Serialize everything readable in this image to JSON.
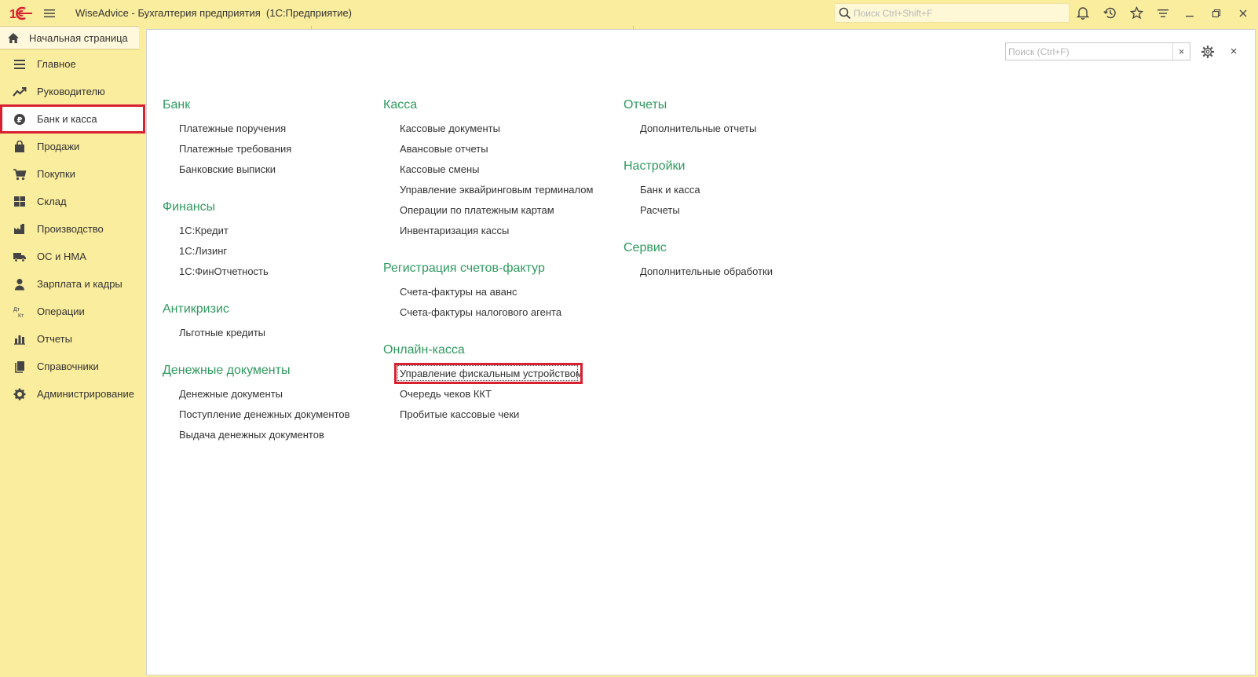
{
  "window": {
    "title": "WiseAdvice - Бухгалтерия предприятия  (1С:Предприятие)",
    "search_placeholder": "Поиск Ctrl+Shift+F"
  },
  "home_tab": {
    "label": "Начальная страница"
  },
  "sidebar": {
    "items": [
      {
        "label": "Главное",
        "icon": "main-menu-icon"
      },
      {
        "label": "Руководителю",
        "icon": "trend-icon"
      },
      {
        "label": "Банк и касса",
        "icon": "ruble-coin-icon",
        "active": true
      },
      {
        "label": "Продажи",
        "icon": "shopping-bag-icon"
      },
      {
        "label": "Покупки",
        "icon": "cart-icon"
      },
      {
        "label": "Склад",
        "icon": "warehouse-icon"
      },
      {
        "label": "Производство",
        "icon": "factory-icon"
      },
      {
        "label": "ОС и НМА",
        "icon": "truck-icon"
      },
      {
        "label": "Зарплата и кадры",
        "icon": "person-icon"
      },
      {
        "label": "Операции",
        "icon": "dt-kt-icon"
      },
      {
        "label": "Отчеты",
        "icon": "bar-chart-icon"
      },
      {
        "label": "Справочники",
        "icon": "books-icon"
      },
      {
        "label": "Администрирование",
        "icon": "gear-icon"
      }
    ]
  },
  "panel": {
    "search_placeholder": "Поиск (Ctrl+F)",
    "clear_label": "×",
    "close_label": "×",
    "columns": [
      {
        "sections": [
          {
            "title": "Банк",
            "links": [
              "Платежные поручения",
              "Платежные требования",
              "Банковские выписки"
            ]
          },
          {
            "title": "Финансы",
            "links": [
              "1С:Кредит",
              "1С:Лизинг",
              "1С:ФинОтчетность"
            ]
          },
          {
            "title": "Антикризис",
            "links": [
              "Льготные кредиты"
            ]
          },
          {
            "title": "Денежные документы",
            "links": [
              "Денежные документы",
              "Поступление денежных документов",
              "Выдача денежных документов"
            ]
          }
        ]
      },
      {
        "sections": [
          {
            "title": "Касса",
            "links": [
              "Кассовые документы",
              "Авансовые отчеты",
              "Кассовые смены",
              "Управление эквайринговым терминалом",
              "Операции по платежным картам",
              "Инвентаризация кассы"
            ]
          },
          {
            "title": "Регистрация счетов-фактур",
            "links": [
              "Счета-фактуры на аванс",
              "Счета-фактуры налогового агента"
            ]
          },
          {
            "title": "Онлайн-касса",
            "links": [
              "Управление фискальным устройством",
              "Очередь чеков ККТ",
              "Пробитые кассовые чеки"
            ]
          }
        ]
      },
      {
        "sections": [
          {
            "title": "Отчеты",
            "links": [
              "Дополнительные отчеты"
            ]
          },
          {
            "title": "Настройки",
            "links": [
              "Банк и касса",
              "Расчеты"
            ]
          },
          {
            "title": "Сервис",
            "links": [
              "Дополнительные обработки"
            ]
          }
        ]
      }
    ]
  },
  "colors": {
    "accent_green": "#2f9a5f",
    "sidebar_bg": "#fbed9e",
    "highlight_red": "#d8202f"
  }
}
